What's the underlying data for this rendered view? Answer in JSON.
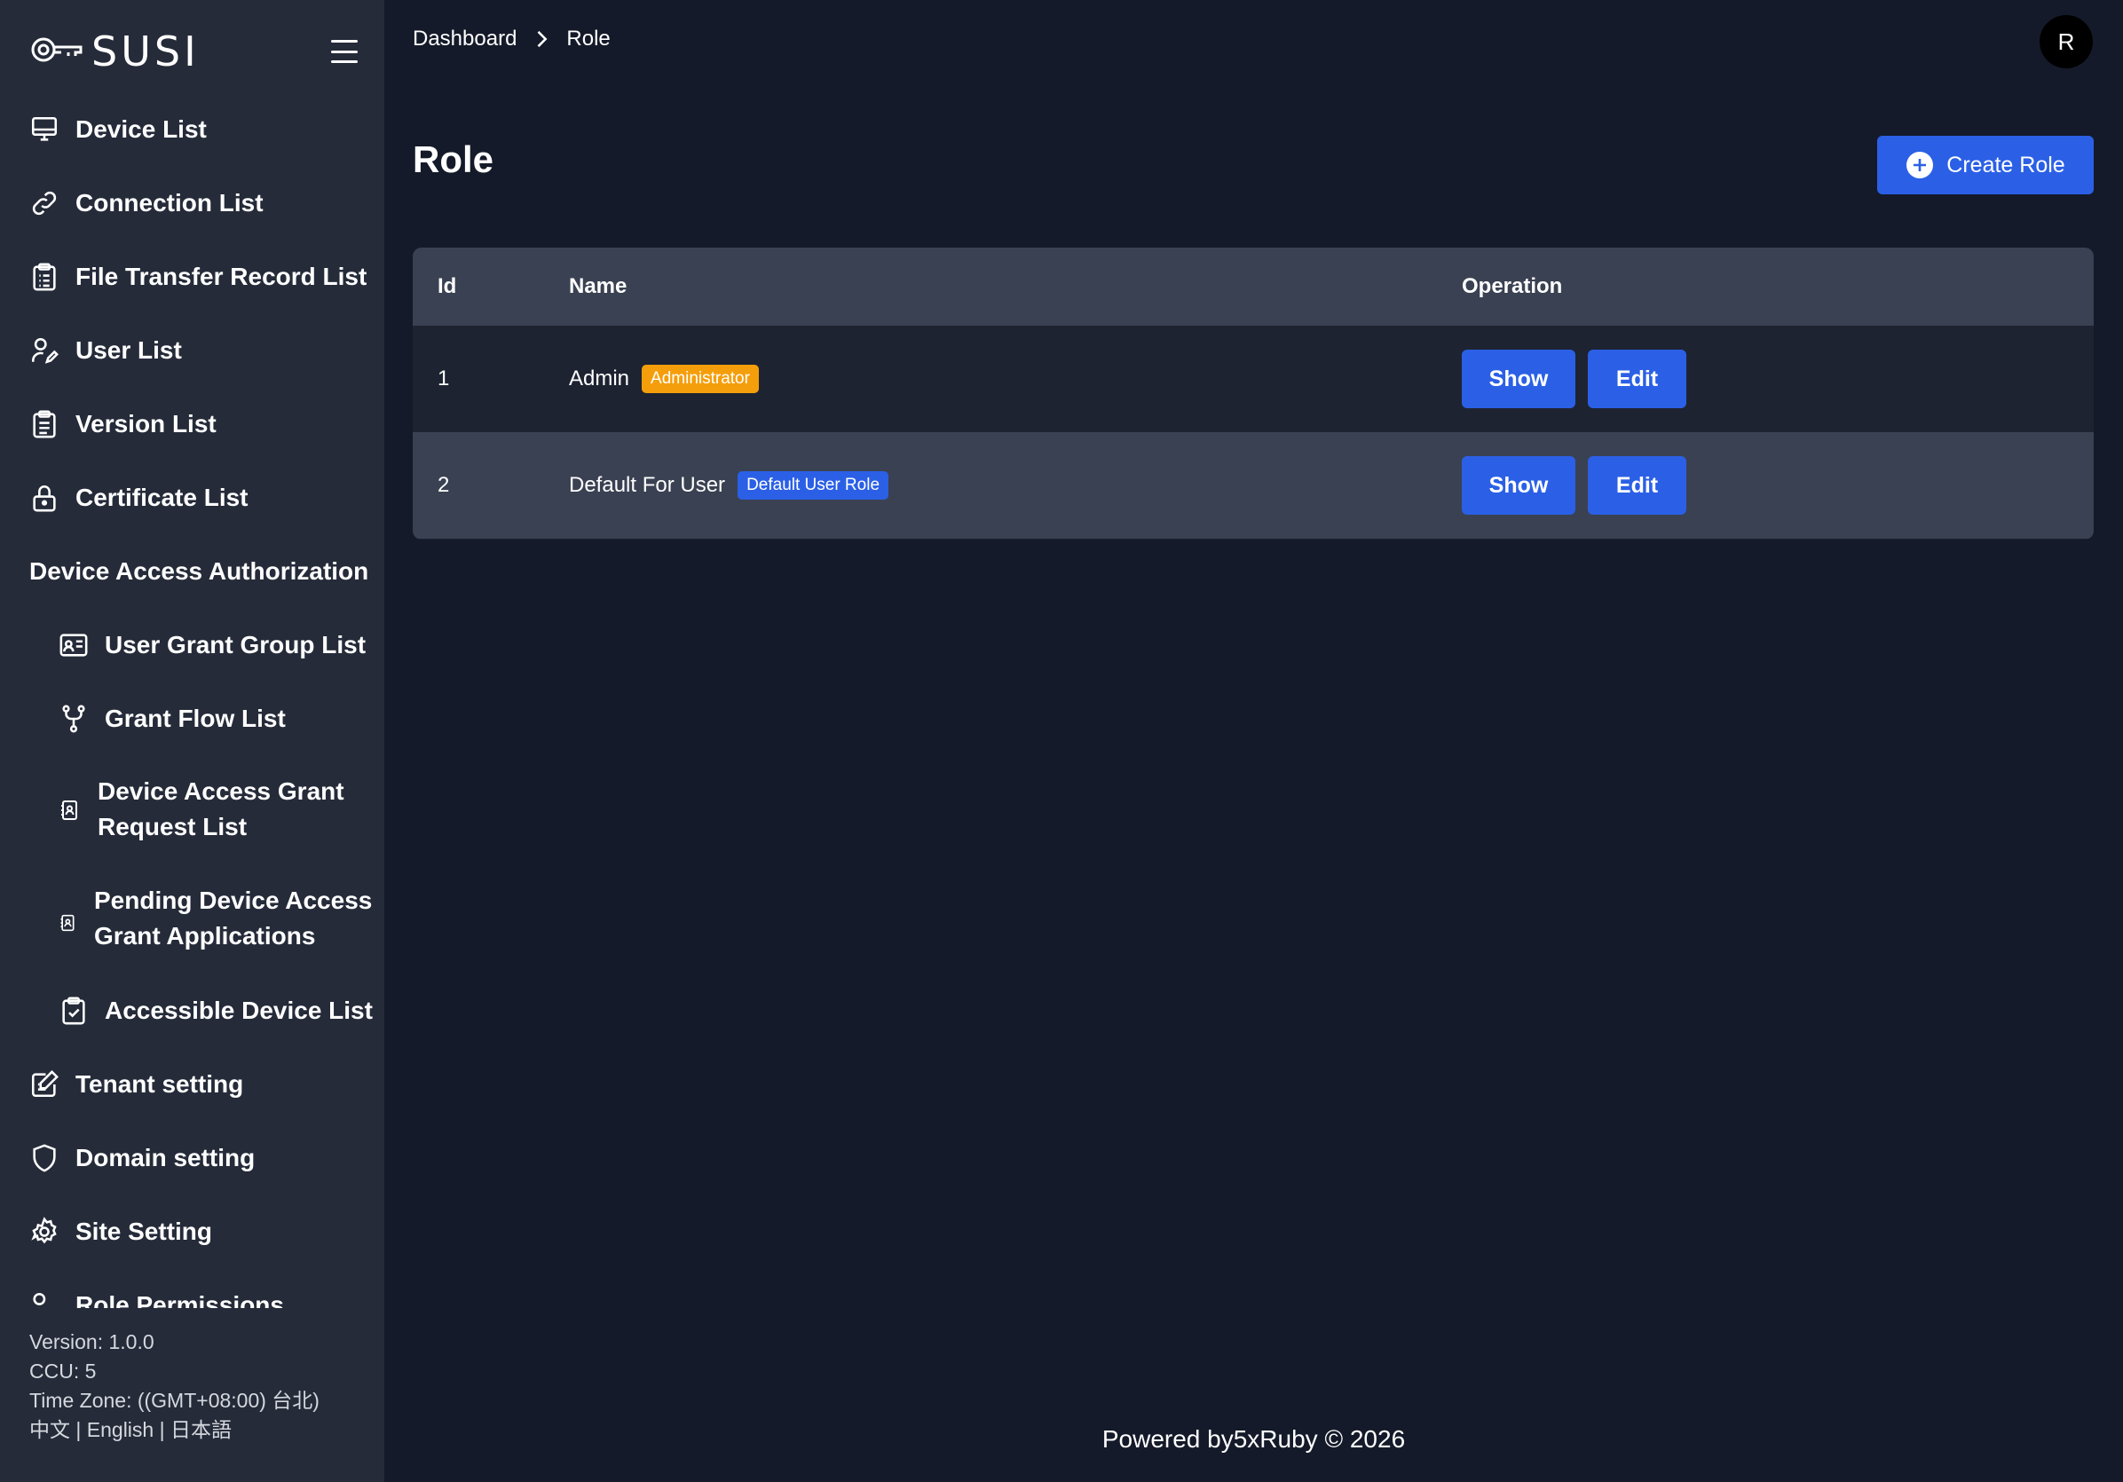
{
  "app": {
    "logo_text": "SUSI"
  },
  "sidebar": {
    "items": [
      {
        "label": "Device List",
        "icon": "monitor-icon"
      },
      {
        "label": "Connection List",
        "icon": "link-icon"
      },
      {
        "label": "File Transfer Record List",
        "icon": "clipboard-list-icon"
      },
      {
        "label": "User List",
        "icon": "user-pen-icon"
      },
      {
        "label": "Version List",
        "icon": "clipboard-list-icon"
      },
      {
        "label": "Certificate List",
        "icon": "lock-icon"
      }
    ],
    "group_title": "Device Access Authorization",
    "sub_items": [
      {
        "label": "User Grant Group List",
        "icon": "id-card-icon"
      },
      {
        "label": "Grant Flow List",
        "icon": "git-fork-icon"
      },
      {
        "label_line1": "Device Access Grant",
        "label_line2": "Request List",
        "icon": "contact-book-icon"
      },
      {
        "label_line1": "Pending Device Access",
        "label_line2": "Grant Applications",
        "icon": "contact-book-icon"
      },
      {
        "label": "Accessible Device List",
        "icon": "clipboard-check-icon"
      }
    ],
    "bottom_items": [
      {
        "label": "Tenant setting",
        "icon": "edit-note-icon"
      },
      {
        "label": "Domain setting",
        "icon": "shield-icon"
      },
      {
        "label": "Site Setting",
        "icon": "gear-icon"
      },
      {
        "label": "Role Permissions",
        "icon": "user-key-icon"
      }
    ],
    "footer": {
      "version": "Version: 1.0.0",
      "ccu": "CCU: 5",
      "timezone": "Time Zone: ((GMT+08:00) 台北)",
      "lang_zh": "中文",
      "lang_en": "English",
      "lang_ja": "日本語",
      "lang_sep": " | "
    }
  },
  "header": {
    "breadcrumb": [
      "Dashboard",
      "Role"
    ],
    "avatar_initial": "R"
  },
  "main": {
    "title": "Role",
    "create_button": "Create Role",
    "table": {
      "columns": [
        "Id",
        "Name",
        "Operation"
      ],
      "rows": [
        {
          "id": "1",
          "name": "Admin",
          "badge": "Administrator",
          "badge_color": "#f59e0b"
        },
        {
          "id": "2",
          "name": "Default For User",
          "badge": "Default User Role",
          "badge_color": "#2b60e6"
        }
      ],
      "show_label": "Show",
      "edit_label": "Edit"
    }
  },
  "footer": {
    "text": "Powered by5xRuby © 2026"
  },
  "colors": {
    "background": "#141a29",
    "sidebar": "#252b39",
    "accent": "#2b60e6",
    "table_header": "#3a4152",
    "badge_orange": "#f59e0b"
  }
}
